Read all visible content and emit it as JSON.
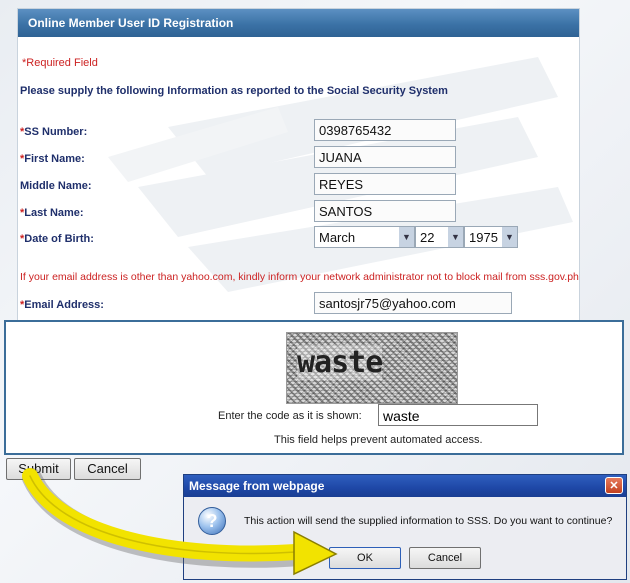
{
  "form": {
    "title": "Online Member User ID Registration",
    "required_note": "*Required Field",
    "instructions": "Please supply the following Information as reported to the Social Security System",
    "fields": {
      "ss_number": {
        "label": "SS Number:",
        "required": true,
        "value": "0398765432"
      },
      "first_name": {
        "label": "First Name:",
        "required": true,
        "value": "JUANA"
      },
      "middle_name": {
        "label": "Middle Name:",
        "required": false,
        "value": "REYES"
      },
      "last_name": {
        "label": "Last Name:",
        "required": true,
        "value": "SANTOS"
      },
      "date_of_birth": {
        "label": "Date of Birth:",
        "required": true,
        "month": "March",
        "day": "22",
        "year": "1975"
      },
      "email": {
        "label": "Email Address:",
        "required": true,
        "value": "santosjr75@yahoo.com"
      }
    },
    "email_warning": "If your email address is other than yahoo.com, kindly inform your network administrator not to block mail from sss.gov.ph.",
    "required_star": "*"
  },
  "captcha": {
    "image_text": "waste",
    "prompt": "Enter the code as it is shown:",
    "input_value": "waste",
    "help": "This field helps prevent automated access."
  },
  "actions": {
    "submit": "Submit",
    "cancel": "Cancel"
  },
  "dialog": {
    "title": "Message from webpage",
    "close": "✕",
    "icon_glyph": "?",
    "message": "This action will send the supplied information to SSS. Do you want to continue?",
    "ok": "OK",
    "cancel": "Cancel"
  },
  "colors": {
    "header_blue": "#3b72a6",
    "required_red": "#cc2222",
    "label_navy": "#1f2f6b",
    "arrow_yellow": "#f2e300"
  }
}
